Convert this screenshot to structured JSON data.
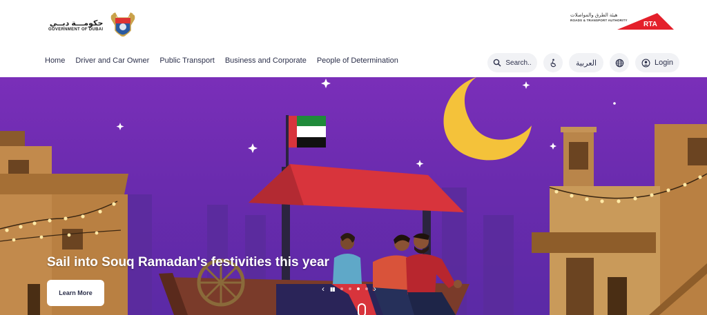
{
  "header": {
    "gov_ar": "حكومـــة دبــي",
    "gov_en": "GOVERNMENT OF DUBAI",
    "rta_ar": "هيئة الطرق والمواصلات",
    "rta_en": "ROADS & TRANSPORT AUTHORITY",
    "rta_mark": "RTA"
  },
  "nav": {
    "links": [
      "Home",
      "Driver and Car Owner",
      "Public Transport",
      "Business and Corporate",
      "People of Determination"
    ],
    "search_label": "Search..",
    "arabic_label": "العربية",
    "login_label": "Login"
  },
  "hero": {
    "title": "Sail into Souq Ramadan's festivities this year",
    "button_label": "Learn More",
    "slide_count": 4,
    "active_slide": 3
  },
  "colors": {
    "sky": "#6a2bae",
    "moon": "#f4c23a",
    "rta_red": "#e4202b",
    "awning": "#d8343c"
  },
  "icons": {
    "search": "search-icon",
    "accessibility": "accessibility-icon",
    "globe": "globe-icon",
    "user": "user-icon",
    "prev": "chevron-left-icon",
    "next": "chevron-right-icon",
    "pause": "pause-icon",
    "scroll": "scroll-mouse-icon"
  }
}
